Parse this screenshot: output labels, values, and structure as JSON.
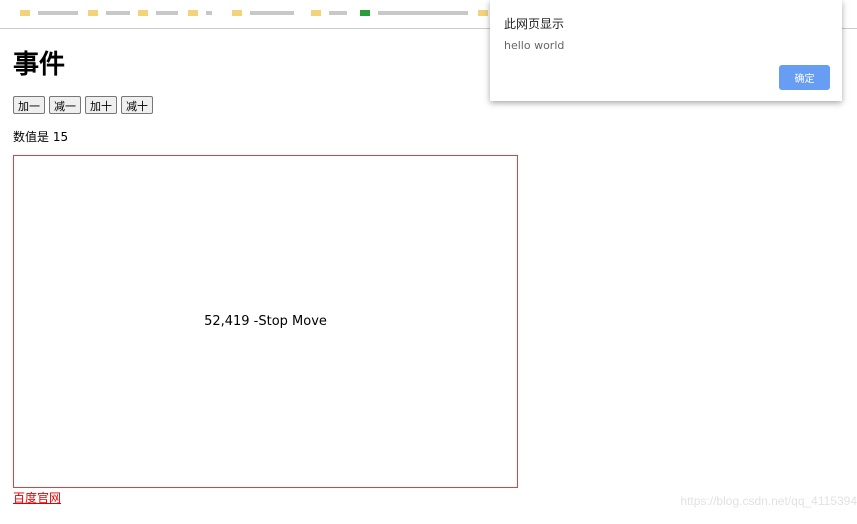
{
  "page": {
    "heading": "事件",
    "buttons": [
      "加一",
      "减一",
      "加十",
      "减十"
    ],
    "value_text": "数值是 15",
    "mouse_box_text": "52,419 -Stop Move",
    "link_text": "百度官网",
    "watermark": "https://blog.csdn.net/qq_4115394"
  },
  "dialog": {
    "title": "此网页显示",
    "message": "hello world",
    "ok_label": "确定"
  },
  "colors": {
    "accent": "#679df3",
    "box_border": "#e04040",
    "link": "#e00000"
  }
}
